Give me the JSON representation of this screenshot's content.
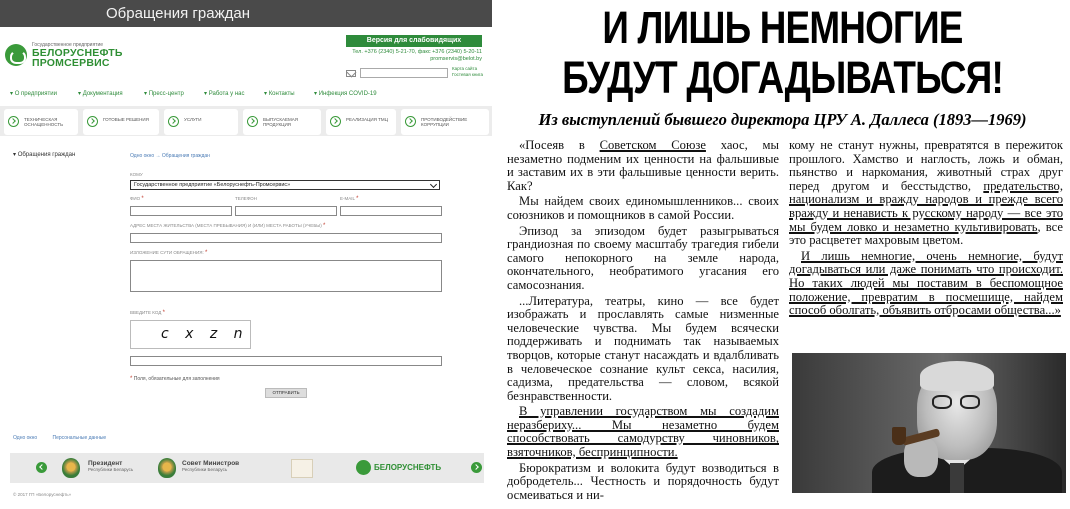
{
  "site": {
    "window_title": "Обращения граждан",
    "logo": {
      "small_caption": "Государственное предприятие",
      "name_line1": "БЕЛОРУСНЕФТЬ",
      "name_line2": "ПРОМСЕРВИС",
      "icon": "belorusneft-logo-icon"
    },
    "version_button": "Версия для слабовидящих",
    "contacts": {
      "phone": "Тел. +376 (2340) 5-21-70, факс +376 (2340) 5-20-11",
      "email": "promservis@belot.by"
    },
    "search": {
      "placeholder": "",
      "hint": "Карта сайта Гостевая книга"
    },
    "nav": [
      "О предприятии",
      "Документация",
      "Пресс-центр",
      "Работа у нас",
      "Контакты",
      "Инфекция COVID-19"
    ],
    "tiles": [
      "ТЕХНИЧЕСКАЯ ОСНАЩЕННОСТЬ",
      "ГОТОВЫЕ РЕШЕНИЯ",
      "УСЛУГИ",
      "ВЫПУСКАЕМАЯ ПРОДУКЦИЯ",
      "РЕАЛИЗАЦИЯ ТМЦ",
      "ПРОТИВОДЕЙСТВИЕ КОРРУПЦИИ"
    ],
    "sidebar_title": "Обращения граждан",
    "breadcrumb": "Одно окно → Обращения граждан",
    "form": {
      "to_label": "КОМУ",
      "to_value": "Государственное предприятие «Белоруснефть-Промсервис»",
      "fio_label": "ФИО",
      "phone_label": "ТЕЛЕФОН",
      "email_label": "E-MAIL",
      "address_label": "АДРЕС МЕСТА ЖИТЕЛЬСТВА (МЕСТА ПРЕБЫВАНИЯ) И (ИЛИ) МЕСТА РАБОТЫ (УЧЕБЫ)",
      "text_label": "ИЗЛОЖЕНИЕ СУТИ ОБРАЩЕНИЯ:",
      "captcha_label": "ВВЕДИТЕ КОД",
      "captcha_value": "c x z n",
      "required_note": "Поля, обязательные для заполнения",
      "submit": "ОТПРАВИТЬ"
    },
    "footer_links": [
      "Одно окно",
      "Персональные данные"
    ],
    "footer": {
      "president": "Президент",
      "president_sub": "Республики Беларусь",
      "council": "Совет Министров",
      "council_sub": "Республики Беларусь",
      "brand": "БЕЛОРУСНЕФТЬ"
    },
    "copyright": "© 2017 ГП «Белоруснефть»",
    "accent": "#2e8b3b"
  },
  "paper": {
    "headline_line1": "И ЛИШЬ НЕМНОГИЕ",
    "headline_line2": "БУДУТ ДОГАДЫВАТЬСЯ!",
    "subtitle": "Из выступлений бывшего директора ЦРУ А. Даллеса (1893—1969)",
    "col1": {
      "p1_a": "«Посеяв в ",
      "p1_u": "Советском Союзе",
      "p1_b": " хаос, мы незаметно подменим их ценности на фальшивые и заставим их в эти фальшивые ценности верить. Как?",
      "p2": "Мы найдем своих единомышленников... своих союзников и помощников в самой России.",
      "p3": "Эпизод за эпизодом будет разыгрываться грандиозная по своему масштабу трагедия гибели самого непокорного на земле народа, окончательного, необратимого угасания его самосознания.",
      "p4": "...Литература, театры, кино — все будет изображать и прославлять самые низменные человеческие чувства. Мы будем всячески поддерживать и поднимать так называемых творцов, которые станут насаждать и вдалбливать в человеческое сознание культ секса, насилия, садизма, предательства — словом, всякой безнравственности.",
      "p5_u": "В управлении государством мы создадим неразбериху... Мы незаметно будем способствовать самодурству чиновников, взяточников, беспринципности.",
      "p6": "Бюрократизм и волокита будут возводиться в добродетель... Честность и порядочность будут осмеиваться и ни-"
    },
    "col2": {
      "p1_a": "кому не станут нужны, превратятся в пережиток прошлого. Хамство и наглость, ложь и обман, пьянство и наркомания, животный страх друг перед другом и бесстыдство, ",
      "p1_u": "предательство, национализм и вражду народов и прежде всего вражду и ненависть к русскому народу — все это мы будем ловко и незаметно культивировать",
      "p1_b": ", все это расцветет махровым цветом.",
      "p2_u": "И лишь немногие, очень немногие, будут догадываться или даже понимать что происходит. Но таких людей мы поставим в беспомощное положение, превратим в посмешище, найдем способ оболгать, объявить отбросами общества...»"
    },
    "photo_subject": "portrait-photo"
  }
}
